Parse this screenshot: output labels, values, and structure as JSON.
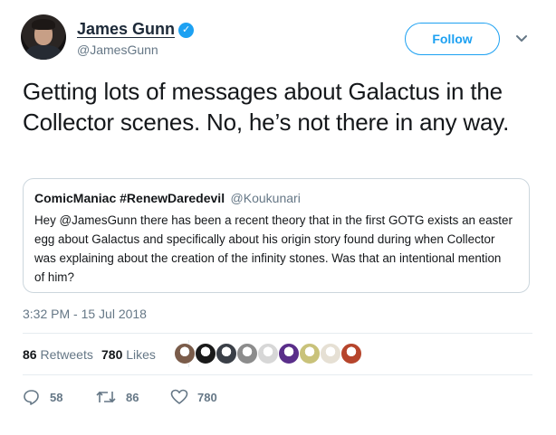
{
  "user": {
    "display_name": "James Gunn",
    "handle": "@JamesGunn",
    "follow_label": "Follow"
  },
  "tweet": {
    "text": "Getting lots of messages about Galactus in the Collector scenes. No, he’s not there in any way."
  },
  "quoted": {
    "author": "ComicManiac #RenewDaredevil",
    "handle": "@Koukunari",
    "text": "Hey @JamesGunn there has been a recent theory that in the first GOTG exists an easter egg about Galactus and specifically about his origin story found during when Collector was explaining about the creation of the infinity stones. Was that an intentional mention of him?"
  },
  "timestamp": "3:32 PM - 15 Jul 2018",
  "stats": {
    "retweets_count": "86",
    "retweets_label": "Retweets",
    "likes_count": "780",
    "likes_label": "Likes"
  },
  "likers": [
    {
      "icon": "liker-avatar-1",
      "color": "#7a5c4a"
    },
    {
      "icon": "liker-avatar-2",
      "color": "#1a1a1a"
    },
    {
      "icon": "liker-avatar-3",
      "color": "#3a3f47"
    },
    {
      "icon": "liker-avatar-4",
      "color": "#8c8c8c"
    },
    {
      "icon": "liker-avatar-5",
      "color": "#d7d7d7"
    },
    {
      "icon": "liker-avatar-6",
      "color": "#5a2e8a"
    },
    {
      "icon": "liker-avatar-7",
      "color": "#c9c27a"
    },
    {
      "icon": "liker-avatar-8",
      "color": "#e6e0d4"
    },
    {
      "icon": "liker-avatar-9",
      "color": "#b6452c"
    }
  ],
  "actions": {
    "replies": "58",
    "retweets": "86",
    "likes": "780"
  },
  "colors": {
    "accent": "#1da1f2",
    "secondary_text": "#657786",
    "border": "#ccd6dd"
  }
}
